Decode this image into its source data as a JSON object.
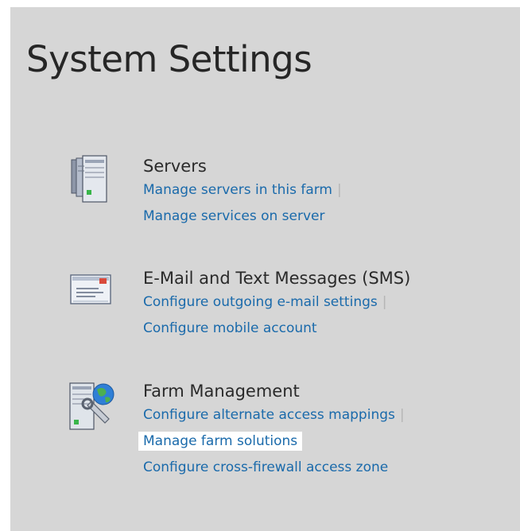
{
  "page": {
    "title": "System Settings"
  },
  "sections": [
    {
      "icon": "servers-icon",
      "title": "Servers",
      "links": [
        "Manage servers in this farm",
        "Manage services on server"
      ]
    },
    {
      "icon": "email-sms-icon",
      "title": "E-Mail and Text Messages (SMS)",
      "links": [
        "Configure outgoing e-mail settings",
        "Configure mobile account"
      ]
    },
    {
      "icon": "farm-management-icon",
      "title": "Farm Management",
      "links": [
        "Configure alternate access mappings",
        "Manage farm solutions",
        "Configure cross-firewall access zone"
      ]
    }
  ],
  "separator": "|",
  "colors": {
    "link": "#1a6aab",
    "background": "#d6d6d6",
    "title": "#262626",
    "highlight": "#ffffff"
  }
}
